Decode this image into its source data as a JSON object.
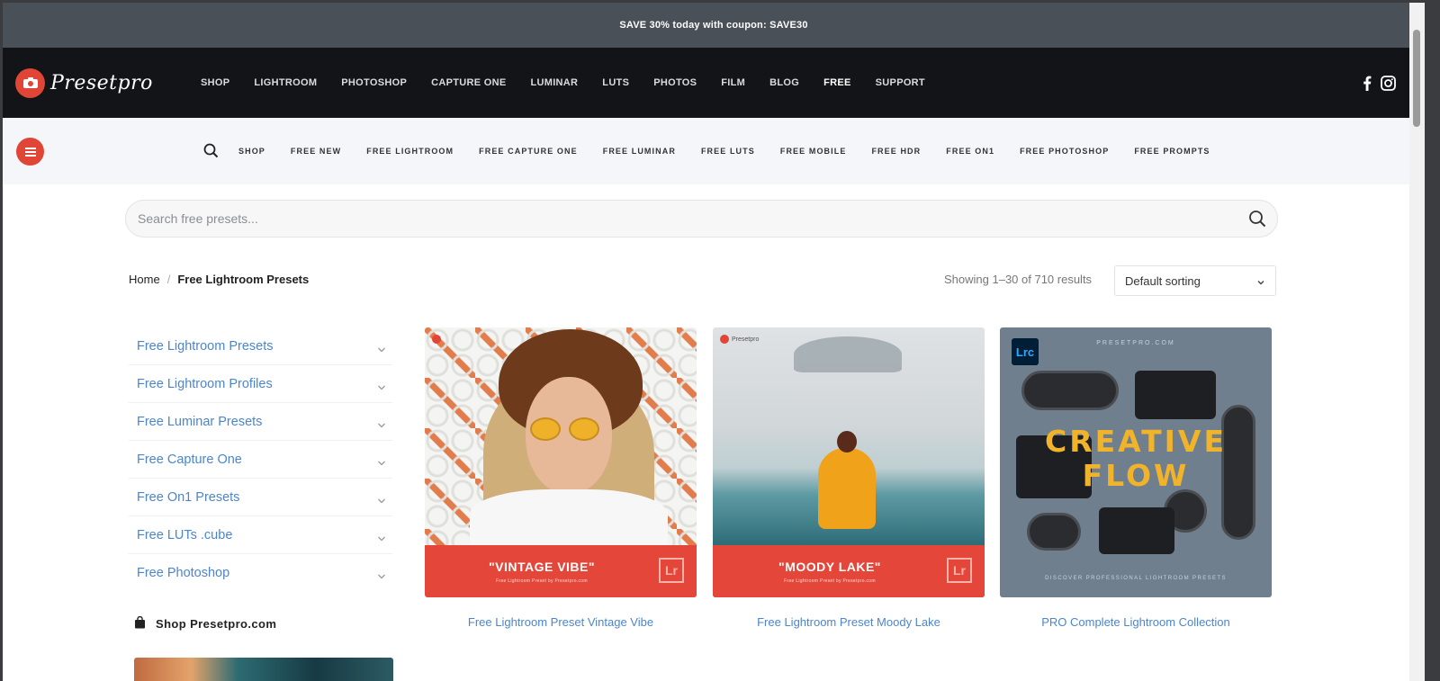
{
  "promo_bar": {
    "text": "SAVE 30% today with coupon: SAVE30"
  },
  "header": {
    "logo_text": "Presetpro",
    "menu": [
      {
        "label": "SHOP"
      },
      {
        "label": "LIGHTROOM"
      },
      {
        "label": "PHOTOSHOP"
      },
      {
        "label": "CAPTURE ONE"
      },
      {
        "label": "LUMINAR"
      },
      {
        "label": "LUTS"
      },
      {
        "label": "PHOTOS"
      },
      {
        "label": "FILM"
      },
      {
        "label": "BLOG"
      },
      {
        "label": "FREE"
      },
      {
        "label": "SUPPORT"
      }
    ],
    "active_menu": "FREE",
    "social": [
      "facebook-icon",
      "instagram-icon"
    ]
  },
  "subnav": {
    "items": [
      {
        "label": "SHOP"
      },
      {
        "label": "FREE NEW"
      },
      {
        "label": "FREE LIGHTROOM"
      },
      {
        "label": "FREE CAPTURE ONE"
      },
      {
        "label": "FREE LUMINAR"
      },
      {
        "label": "FREE LUTS"
      },
      {
        "label": "FREE MOBILE"
      },
      {
        "label": "FREE HDR"
      },
      {
        "label": "FREE ON1"
      },
      {
        "label": "FREE PHOTOSHOP"
      },
      {
        "label": "FREE PROMPTS"
      }
    ]
  },
  "search": {
    "placeholder": "Search free presets..."
  },
  "breadcrumb": {
    "home": "Home",
    "separator": "/",
    "current": "Free Lightroom Presets"
  },
  "results": {
    "text": "Showing 1–30 of 710 results"
  },
  "sorting": {
    "selected": "Default sorting"
  },
  "sidebar": {
    "categories": [
      {
        "label": "Free Lightroom Presets"
      },
      {
        "label": "Free Lightroom Profiles"
      },
      {
        "label": "Free Luminar Presets"
      },
      {
        "label": "Free Capture One"
      },
      {
        "label": "Free On1 Presets"
      },
      {
        "label": "Free LUTs .cube"
      },
      {
        "label": "Free Photoshop"
      }
    ],
    "shop_link": "Shop Presetpro.com"
  },
  "products": [
    {
      "title": "Free Lightroom Preset Vintage Vibe",
      "banner_title": "\"VINTAGE VIBE\"",
      "banner_subtitle": "Free Lightroom Preset by Presetpro.com",
      "badge": "Lr"
    },
    {
      "title": "Free Lightroom Preset Moody Lake",
      "banner_title": "\"MOODY LAKE\"",
      "banner_subtitle": "Free Lightroom Preset by Presetpro.com",
      "badge": "Lr",
      "mini_logo": "Presetpro"
    },
    {
      "title": "PRO Complete Lightroom Collection",
      "top_text": "PRESETPRO.COM",
      "headline_line1": "CREATIVE",
      "headline_line2": "FLOW",
      "bottom_text": "DISCOVER PROFESSIONAL LIGHTROOM PRESETS",
      "badge": "Lrc"
    }
  ],
  "colors": {
    "brand_red": "#e04535",
    "nav_dark": "#121417",
    "promo_bg": "#4a5058",
    "link_blue": "#4a86cf",
    "accent_gold": "#f0b32a"
  }
}
